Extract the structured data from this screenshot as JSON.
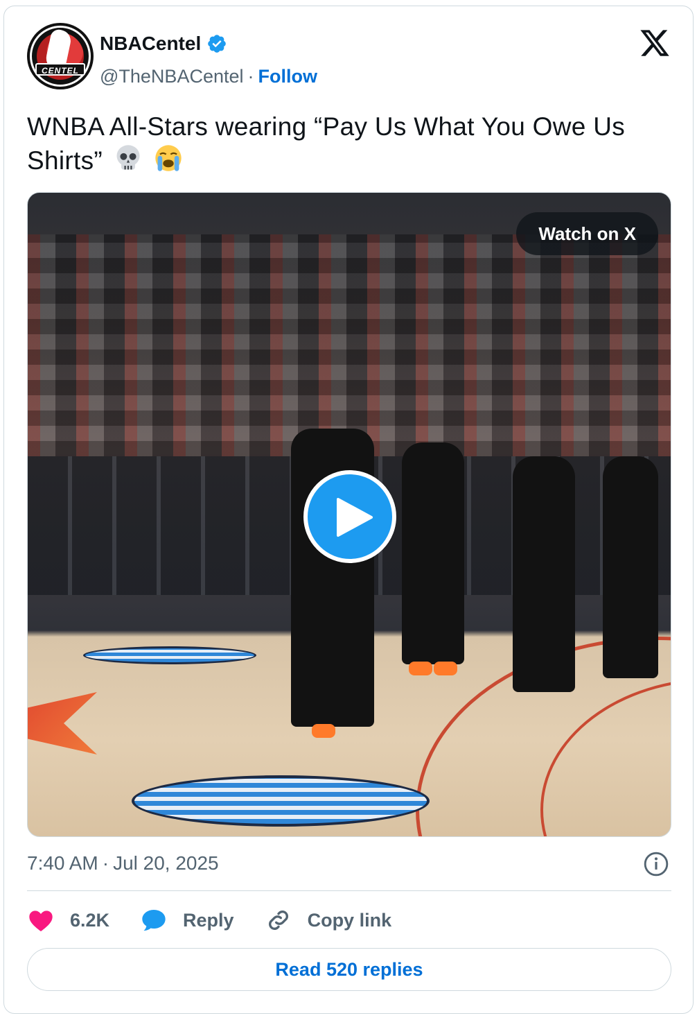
{
  "author": {
    "display_name": "NBACentel",
    "handle": "@TheNBACentel",
    "separator": "·",
    "follow_label": "Follow",
    "avatar_text": "CENTEL",
    "verified_icon": "verified-badge-icon",
    "verified_color": "#1d9bf0"
  },
  "platform": {
    "logo_icon": "x-logo-icon"
  },
  "tweet": {
    "text": "WNBA All-Stars wearing “Pay Us What You Owe Us Shirts”",
    "emojis": [
      "skull-emoji",
      "loudly-crying-face-emoji"
    ]
  },
  "media": {
    "watch_label": "Watch on X",
    "play_icon": "play-icon",
    "play_color": "#1d9bf0"
  },
  "meta": {
    "time": "7:40 AM",
    "separator": "·",
    "date": "Jul 20, 2025",
    "info_icon": "info-icon"
  },
  "actions": {
    "like_count": "6.2K",
    "like_color": "#f91880",
    "reply_label": "Reply",
    "reply_color": "#1d9bf0",
    "copy_label": "Copy link"
  },
  "read_replies_label": "Read 520 replies",
  "link_color": "#006fd6"
}
